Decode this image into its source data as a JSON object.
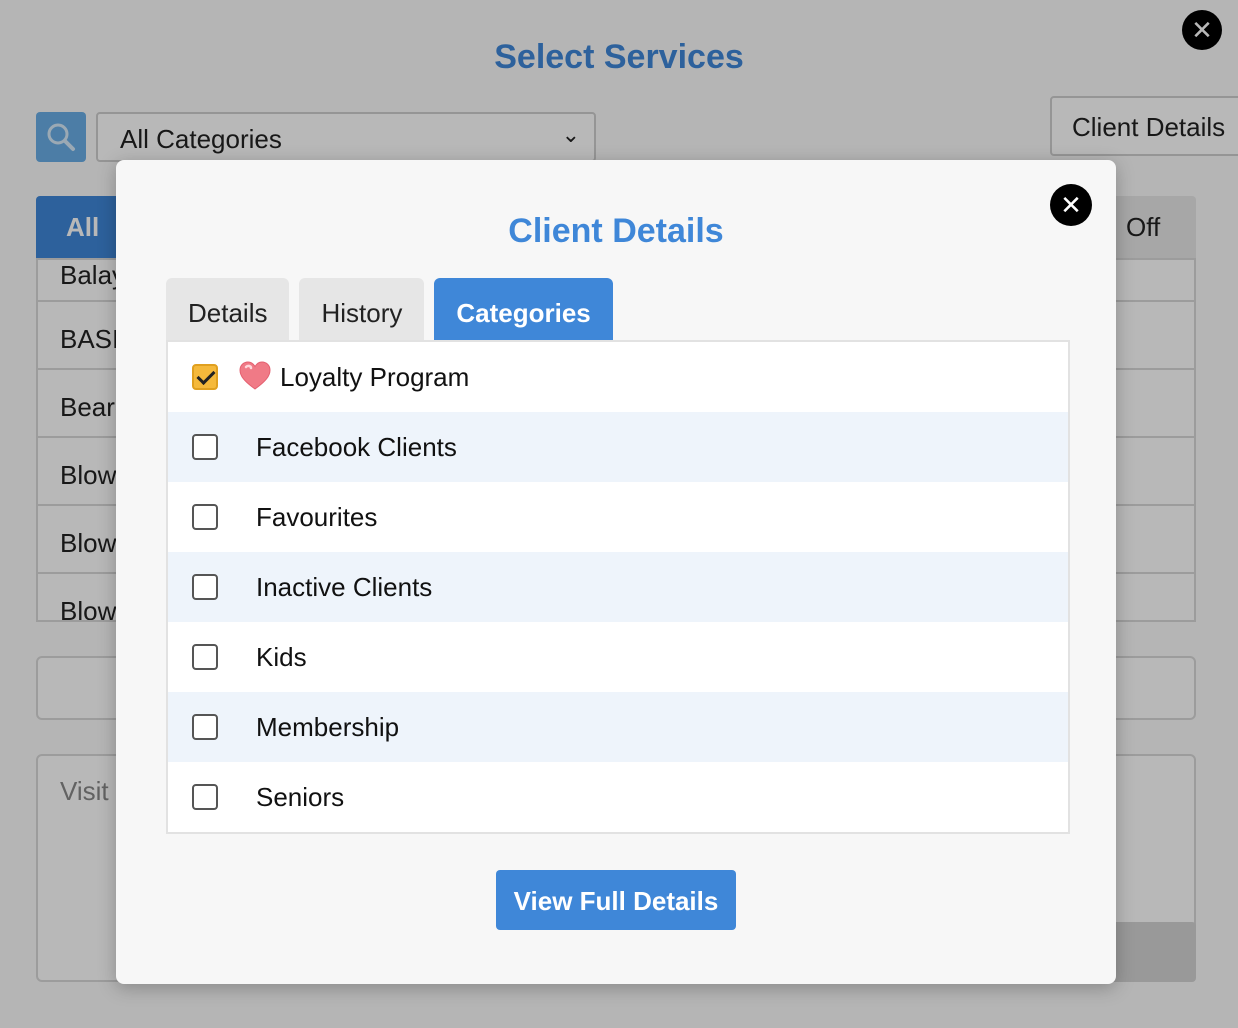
{
  "background": {
    "title": "Select Services",
    "category_select": {
      "value": "All Categories"
    },
    "client_details_button": "Client Details",
    "tab_all": "All",
    "tab_right_partial": "Off",
    "list_items": [
      "Balay",
      "BASI",
      "Beard",
      "Blow",
      "Blow",
      "Blow"
    ],
    "notes_placeholder": "Visit"
  },
  "modal": {
    "title": "Client Details",
    "tabs": [
      {
        "label": "Details",
        "active": false
      },
      {
        "label": "History",
        "active": false
      },
      {
        "label": "Categories",
        "active": true
      }
    ],
    "categories": [
      {
        "label": "Loyalty Program",
        "checked": true,
        "icon": "heart-icon"
      },
      {
        "label": "Facebook Clients",
        "checked": false
      },
      {
        "label": "Favourites",
        "checked": false
      },
      {
        "label": "Inactive Clients",
        "checked": false
      },
      {
        "label": "Kids",
        "checked": false
      },
      {
        "label": "Membership",
        "checked": false
      },
      {
        "label": "Seniors",
        "checked": false
      }
    ],
    "view_full_details_button": "View Full Details"
  },
  "colors": {
    "accent": "#3f87d8",
    "checkbox_checked": "#f5b93b",
    "row_alt": "#eef4fb",
    "heart": "#f07a86"
  }
}
